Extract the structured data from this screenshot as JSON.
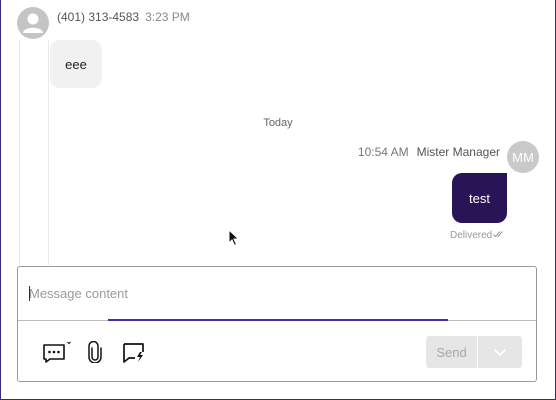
{
  "conversation": {
    "incoming": {
      "sender": "(401) 313-4583",
      "time": "3:23 PM",
      "text": "eee",
      "avatar_icon": "person-icon"
    },
    "day_divider": "Today",
    "outgoing": {
      "time": "10:54 AM",
      "sender": "Mister Manager",
      "avatar_initials": "MM",
      "text": "test",
      "status": "Delivered",
      "status_icon": "double-check-icon"
    }
  },
  "composer": {
    "placeholder": "Message content",
    "value": "",
    "tools": [
      "template-message-icon",
      "attachment-icon",
      "quick-reply-icon"
    ],
    "send_label": "Send",
    "send_enabled": false
  },
  "colors": {
    "accent": "#4b2aa8",
    "outgoing_bubble": "#2a1458",
    "incoming_bubble": "#f1f1f1",
    "frame": "#3b2a7a"
  }
}
